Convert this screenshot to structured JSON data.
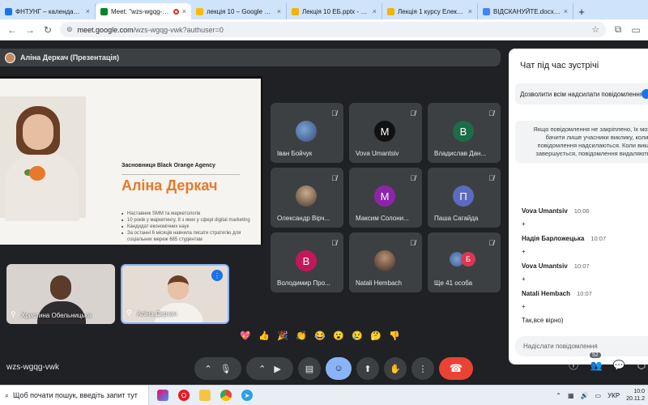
{
  "browser": {
    "tabs": [
      {
        "label": "ФНТУНГ – календар - 4 л",
        "favicon_color": "#1a73e8",
        "active": false
      },
      {
        "label": "Meet: \"wzs-wgqg-vwk\"",
        "favicon_color": "#00832d",
        "active": true
      },
      {
        "label": "лекція 10 – Google Диск",
        "favicon_color": "#fbbc04",
        "active": false
      },
      {
        "label": "Лекція 10 ЕБ.pptx - Googl",
        "favicon_color": "#f4b400",
        "active": false
      },
      {
        "label": "Лекція 1 курсу Електронн",
        "favicon_color": "#f4b400",
        "active": false
      },
      {
        "label": "ВІДСКАНУЙТЕ.docx - Goo",
        "favicon_color": "#4285f4",
        "active": false
      }
    ],
    "new_tab": "+",
    "url_host": "meet.google.com",
    "url_path": "/wzs-wgqg-vwk?authuser=0"
  },
  "presentation": {
    "header": "Аліна Деркач (Презентація)",
    "slide": {
      "founder": "Засновниця Black Orange Agency",
      "name": "Аліна Деркач",
      "bullets": [
        "Наставник SMM та маркетологів",
        "10 років у маркетингу, 8 з яких у сфері digital marketing",
        "Кандидат економічних наук",
        "За останні 6 місяців навчила писати стратегію для соціальних мереж 685 студентам"
      ]
    }
  },
  "self_tiles": [
    {
      "name": "Христина Обельницька"
    },
    {
      "name": "Аліна Деркач"
    }
  ],
  "participants": [
    {
      "name": "Іван Бойчук",
      "initial": "",
      "avatar": "img1",
      "color": ""
    },
    {
      "name": "Vova Umantsiv",
      "initial": "M",
      "avatar": "letter",
      "color": "#111111"
    },
    {
      "name": "Владислав Дан...",
      "initial": "В",
      "avatar": "letter",
      "color": "#1e6b4a"
    },
    {
      "name": "Олександр Вірч...",
      "initial": "",
      "avatar": "img2",
      "color": ""
    },
    {
      "name": "Максим Солони...",
      "initial": "М",
      "avatar": "letter",
      "color": "#8e24aa"
    },
    {
      "name": "Паша Сагайда",
      "initial": "П",
      "avatar": "letter",
      "color": "#5c6bc0"
    },
    {
      "name": "Володимир Про...",
      "initial": "В",
      "avatar": "letter",
      "color": "#c2185b"
    },
    {
      "name": "Natali Hembach",
      "initial": "",
      "avatar": "img3",
      "color": ""
    },
    {
      "name": "Ще 41 особа",
      "initial": "Б",
      "avatar": "more",
      "color": "#d93855"
    }
  ],
  "chat": {
    "title": "Чат під час зустрічі",
    "allow_label": "Дозволити всім надсилати повідомлення",
    "notice": "Якщо повідомлення не закріплено, їх можуть бачити лише учасники виклику, коли повідомлення надсилаються. Коли виклик завершується, повідомлення видаляються.",
    "messages": [
      {
        "author": "Vova Umantsiv",
        "time": "10:06",
        "text": "+"
      },
      {
        "author": "Надія Барложецька",
        "time": "10:07",
        "text": "+"
      },
      {
        "author": "Vova Umantsiv",
        "time": "10:07",
        "text": "+"
      },
      {
        "author": "Natali Hembach",
        "time": "10:07",
        "text": "+"
      },
      {
        "author": "",
        "time": "",
        "text": "Так,все вірно)"
      }
    ],
    "input_placeholder": "Надіслати повідомлення"
  },
  "reactions": [
    "💖",
    "👍",
    "🎉",
    "👏",
    "😂",
    "😮",
    "😢",
    "🤔",
    "👎"
  ],
  "controls": {
    "meeting_code": "wzs-wgqg-vwk",
    "participant_count": "52"
  },
  "taskbar": {
    "search_placeholder": "Щоб почати пошук, введіть запит тут",
    "language": "УКР",
    "time": "10:0",
    "date": "20.11.2"
  }
}
